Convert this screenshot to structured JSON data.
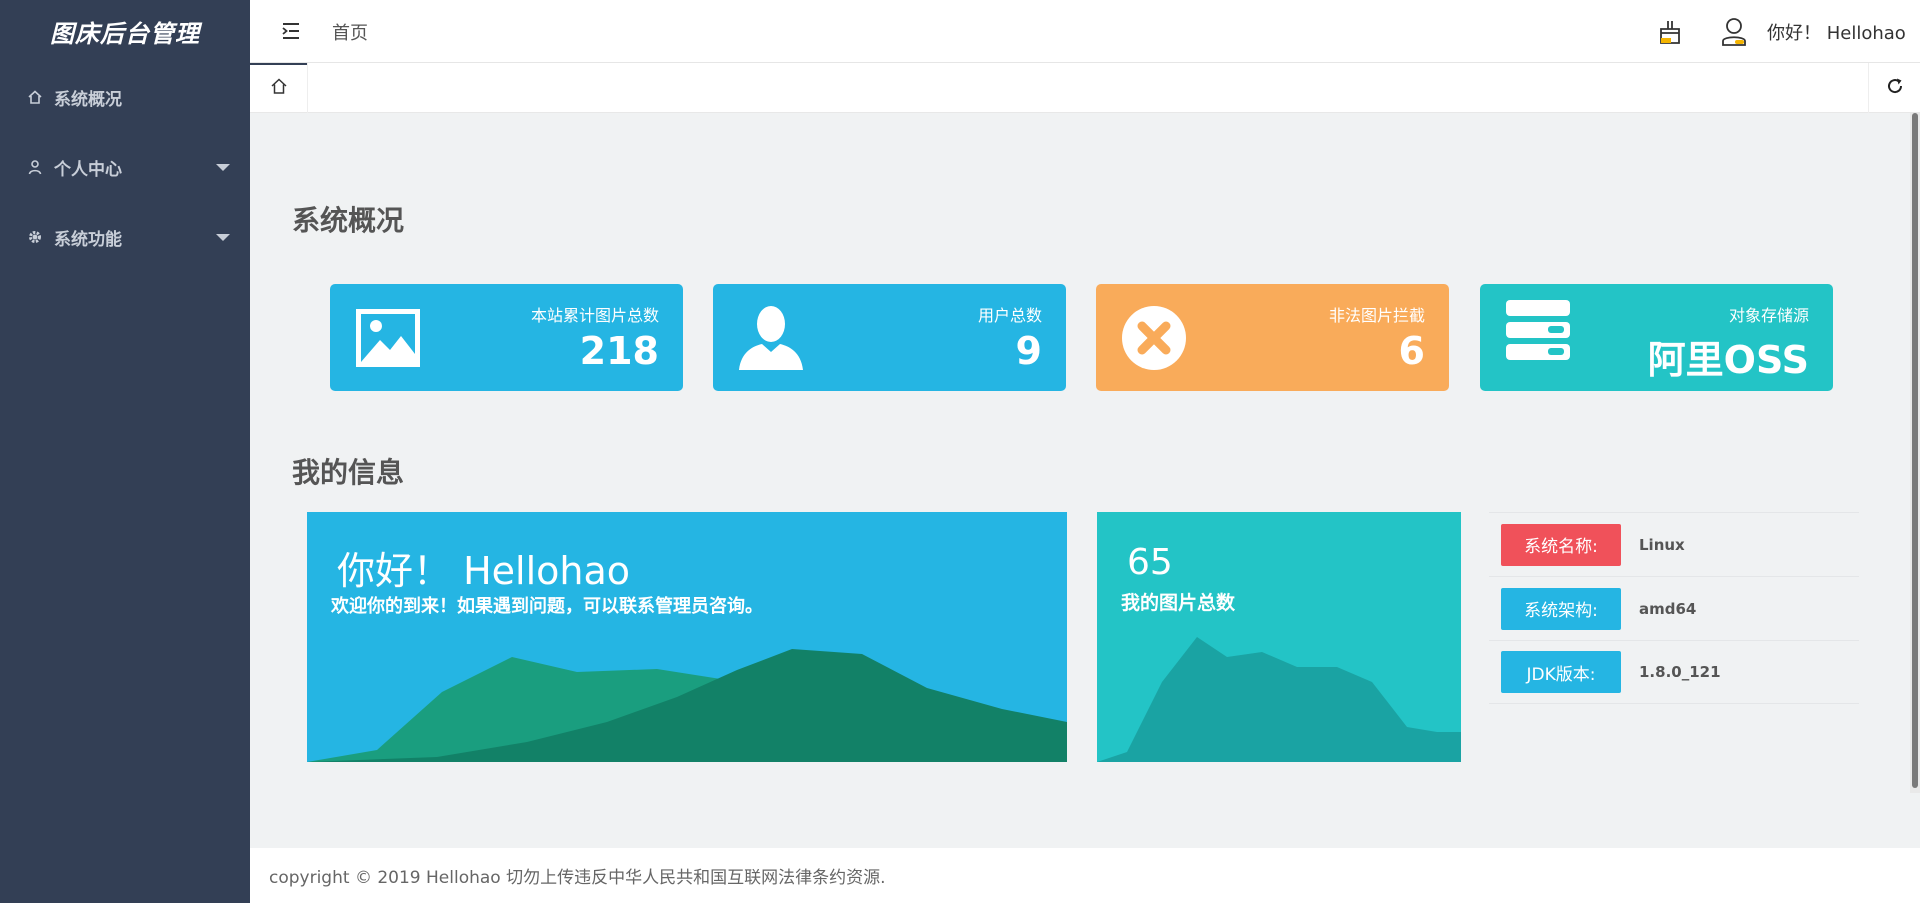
{
  "app": {
    "title": "图床后台管理"
  },
  "sidebar": {
    "items": [
      {
        "label": "系统概况",
        "icon": "home-icon"
      },
      {
        "label": "个人中心",
        "icon": "user-icon",
        "expandable": true
      },
      {
        "label": "系统功能",
        "icon": "gear-icon",
        "expandable": true
      }
    ]
  },
  "header": {
    "breadcrumb": "首页",
    "greeting": "你好！ Hellohao",
    "icons": [
      "menu-fold-icon",
      "theme-icon",
      "user-icon"
    ]
  },
  "tabs": {
    "icons": [
      "home-icon",
      "refresh-icon"
    ]
  },
  "main": {
    "overview_title": "系统概况",
    "info_title": "我的信息",
    "stats": [
      {
        "label": "本站累计图片总数",
        "value": "218",
        "icon": "image-icon",
        "color": "#25b5e3"
      },
      {
        "label": "用户总数",
        "value": "9",
        "icon": "person-icon",
        "color": "#25b5e3"
      },
      {
        "label": "非法图片拦截",
        "value": "6",
        "icon": "close-circle-icon",
        "color": "#f9ab5a"
      },
      {
        "label": "对象存储源",
        "value": "阿里OSS",
        "icon": "server-icon",
        "color": "#23c4c6"
      }
    ],
    "welcome": {
      "hello": "你好！ Hellohao",
      "message": "欢迎你的到来！如果遇到问题，可以联系管理员咨询。"
    },
    "my_images": {
      "count": "65",
      "label": "我的图片总数"
    },
    "system": [
      {
        "label": "系统名称:",
        "value": "Linux",
        "color": "#f0515a"
      },
      {
        "label": "系统架构:",
        "value": "amd64",
        "color": "#25b5e3"
      },
      {
        "label": "JDK版本:",
        "value": "1.8.0_121",
        "color": "#25b5e3"
      }
    ]
  },
  "footer": {
    "text": "copyright © 2019 Hellohao 切勿上传违反中华人民共和国互联网法律条约资源."
  }
}
